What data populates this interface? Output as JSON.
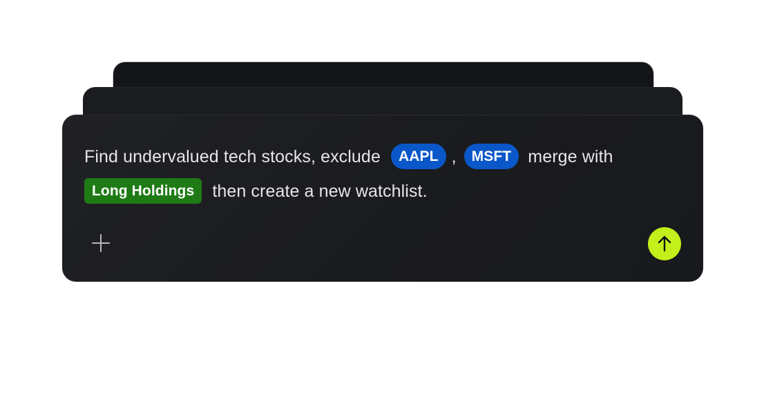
{
  "prompt": {
    "part1": "Find undervalued tech stocks, exclude",
    "chip_aapl": "AAPL",
    "separator": ",",
    "chip_msft": "MSFT",
    "part2": "merge with",
    "chip_list": "Long Holdings",
    "part3": "then create a new watchlist."
  },
  "actions": {
    "add_icon": "plus-icon",
    "send_icon": "arrow-up-icon"
  },
  "colors": {
    "ticker_chip": "#0a57c9",
    "list_chip": "#1f7a16",
    "send_button": "#c3f01a",
    "card_background": "#1c1d21"
  }
}
